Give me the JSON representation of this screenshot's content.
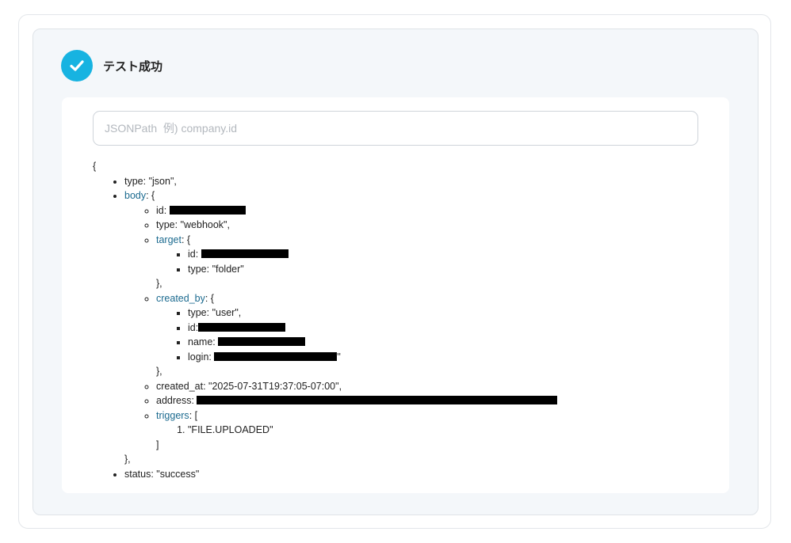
{
  "status": {
    "title": "テスト成功",
    "icon": "check-icon",
    "accent": "#17b3e1"
  },
  "search": {
    "placeholder": "JSONPath  例) company.id",
    "value": ""
  },
  "tree": {
    "open_brace": "{",
    "type_line": "type: \"json\",",
    "body_key": "body",
    "body_open": ": {",
    "body_id_label": "id: ",
    "body_type_line": "type: \"webhook\",",
    "target_key": "target",
    "target_open": ": {",
    "target_id_label": "id: ",
    "target_type_line": "type: \"folder\"",
    "target_close": "},",
    "created_by_key": "created_by",
    "created_by_open": ": {",
    "cb_type_line": "type: \"user\",",
    "cb_id_label": "id:",
    "cb_name_label": "name: ",
    "cb_login_label": "login: ",
    "cb_login_suffix": "\"",
    "created_by_close": "},",
    "created_at_line": "created_at: \"2025-07-31T19:37:05-07:00\",",
    "address_label": "address: ",
    "triggers_key": "triggers",
    "triggers_open": ": [",
    "trigger_item": "\"FILE.UPLOADED\"",
    "triggers_close": "]",
    "body_close": "},",
    "status_line": "status: \"success\""
  }
}
